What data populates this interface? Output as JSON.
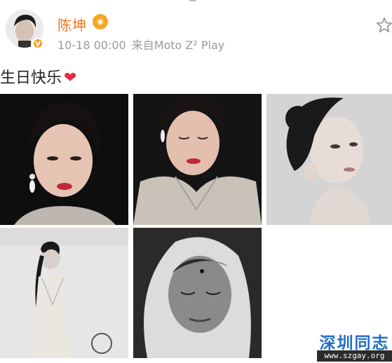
{
  "post": {
    "username": "陈坤",
    "member_badge": "💎",
    "timestamp": "10-18 00:00",
    "source": "来自Moto Z² Play",
    "text": "生日快乐",
    "heart": "❤"
  },
  "icons": {
    "verified": "verified-v-badge",
    "favorite": "star-outline"
  },
  "photos": [
    {
      "subject": "woman portrait with pearl earring, black background"
    },
    {
      "subject": "woman looking down, sequined dress"
    },
    {
      "subject": "woman profile with bun, grey background"
    },
    {
      "subject": "woman standing in white dress, grayscale"
    },
    {
      "subject": "face with hood, grayscale close-up"
    }
  ],
  "watermark": {
    "title": "深圳同志",
    "url": "www.szgay.org"
  },
  "colors": {
    "username": "#f0731b",
    "meta": "#9a9a9a",
    "verified": "#f7a01a",
    "heart": "#e03040",
    "watermark_blue": "#1f6fc8"
  }
}
